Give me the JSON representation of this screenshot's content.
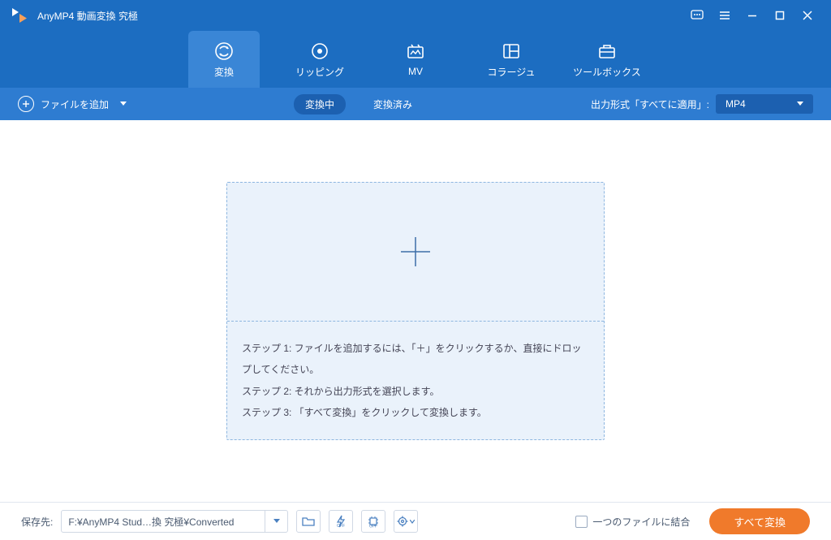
{
  "titlebar": {
    "title": "AnyMP4 動画変換 究極"
  },
  "nav": {
    "items": [
      {
        "label": "変換"
      },
      {
        "label": "リッピング"
      },
      {
        "label": "MV"
      },
      {
        "label": "コラージュ"
      },
      {
        "label": "ツールボックス"
      }
    ]
  },
  "subbar": {
    "addfile_label": "ファイルを追加",
    "tab_converting": "変換中",
    "tab_converted": "変換済み",
    "output_format_label": "出力形式「すべてに適用」:",
    "output_format_value": "MP4"
  },
  "steps": {
    "s1": "ステップ 1: ファイルを追加するには、「＋」をクリックするか、直接にドロップしてください。",
    "s2": "ステップ 2: それから出力形式を選択します。",
    "s3": "ステップ 3: 「すべて変換」をクリックして変換します。"
  },
  "bottom": {
    "saveto_label": "保存先:",
    "path": "F:¥AnyMP4 Stud…換 究極¥Converted",
    "merge_label": "一つのファイルに結合",
    "convert_label": "すべて変換"
  }
}
